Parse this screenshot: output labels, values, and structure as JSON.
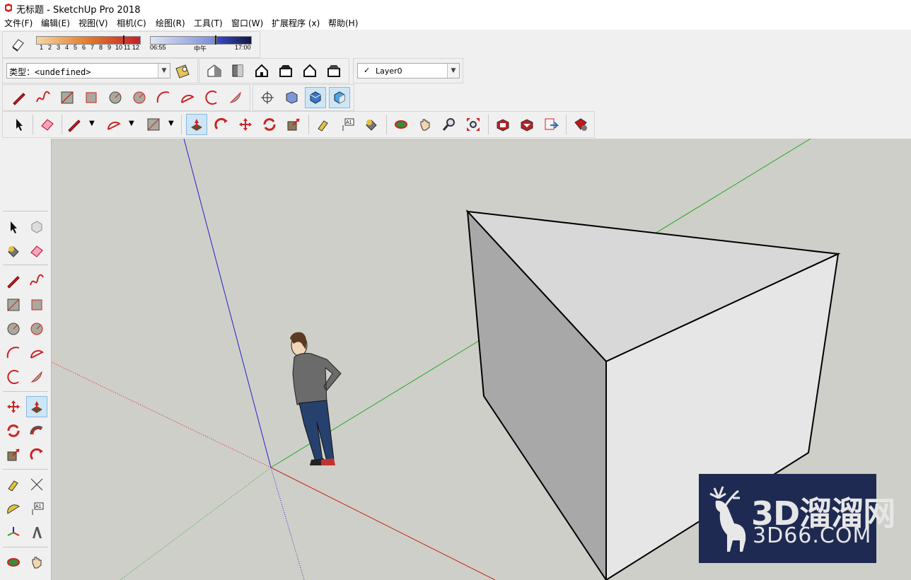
{
  "window": {
    "title": "无标题 - SketchUp Pro 2018"
  },
  "menu": [
    "文件(F)",
    "编辑(E)",
    "视图(V)",
    "相机(C)",
    "绘图(R)",
    "工具(T)",
    "窗口(W)",
    "扩展程序 (x)",
    "帮助(H)"
  ],
  "shadows": {
    "months": [
      "1",
      "2",
      "3",
      "4",
      "5",
      "6",
      "7",
      "8",
      "9",
      "10",
      "11",
      "12"
    ],
    "time_start": "06:55",
    "time_mid": "中午",
    "time_end": "17:00"
  },
  "type_selector": {
    "value": "类型：<undefined>"
  },
  "layer": {
    "check": "✓",
    "value": "Layer0"
  },
  "watermark": {
    "line1": "3D溜溜网",
    "line2": "3D66.COM"
  },
  "colors": {
    "accent": "#cde6f7",
    "red_axis": "#d22",
    "green_axis": "#2a2",
    "blue_axis": "#22c"
  }
}
